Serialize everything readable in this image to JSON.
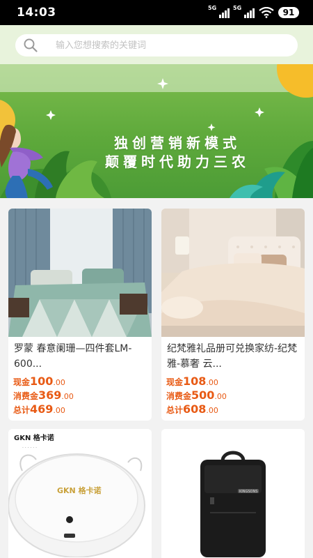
{
  "status_bar": {
    "time": "14:03",
    "sim1": "5G",
    "sim2": "5G",
    "battery": "91"
  },
  "search": {
    "placeholder": "输入您想搜索的关键词"
  },
  "banner": {
    "line1": "独创营销新模式",
    "line2": "颠覆时代助力三农"
  },
  "products": [
    {
      "title": "罗蒙 春意阑珊—四件套LM-600...",
      "cash_label": "现金",
      "cash_int": "100",
      "cash_dec": ".00",
      "consume_label": "消费金",
      "consume_int": "369",
      "consume_dec": ".00",
      "total_label": "总计",
      "total_int": "469",
      "total_dec": ".00"
    },
    {
      "title": "纪梵雅礼品册可兑换家纺-纪梵雅-慕奢 云...",
      "cash_label": "现金",
      "cash_int": "108",
      "cash_dec": ".00",
      "consume_label": "消费金",
      "consume_int": "500",
      "consume_dec": ".00",
      "total_label": "总计",
      "total_int": "608",
      "total_dec": ".00"
    },
    {
      "brand": "GKN 格卡诺",
      "robot_brand": "GKN 格卡诺"
    },
    {
      "bag_brand": "KINGSONS"
    }
  ]
}
